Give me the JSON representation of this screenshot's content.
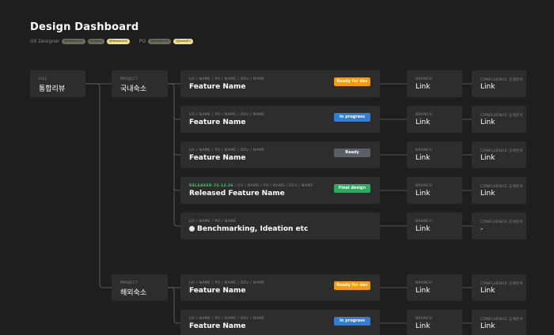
{
  "header": {
    "title": "Design Dashboard",
    "ux_label": "UX Designer",
    "ux_chips": [
      "@Member/UX",
      "@Design",
      "@Member/UX"
    ],
    "sep": "·",
    "po_label": "PO",
    "po_chips": [
      "@Member/PO",
      "@Jones/PO"
    ]
  },
  "file": {
    "label": "FILE",
    "name": "통합리뷰"
  },
  "projects": [
    {
      "label": "PROJECT",
      "name": "국내숙소"
    },
    {
      "label": "PROJECT",
      "name": "해외숙소"
    }
  ],
  "features": [
    {
      "meta": "UX / NAME / PO / NAME / DEV / NAME",
      "released": "",
      "title": "Feature Name",
      "status": "Ready for dev",
      "status_color": "#f39c12",
      "branch_label": "BRANCH",
      "branch": "Link",
      "conf_label": "CONFLUENCE 상세문서",
      "conf": "Link"
    },
    {
      "meta": "UX / NAME / PO / NAME / DEV / NAME",
      "released": "",
      "title": "Feature Name",
      "status": "In progress",
      "status_color": "#2f7ed8",
      "branch_label": "BRANCH",
      "branch": "Link",
      "conf_label": "CONFLUENCE 상세문서",
      "conf": "Link"
    },
    {
      "meta": "UX / NAME / PO / NAME / DEV / NAME",
      "released": "",
      "title": "Feature Name",
      "status": "Ready",
      "status_color": "#5b5f66",
      "branch_label": "BRANCH",
      "branch": "Link",
      "conf_label": "CONFLUENCE 상세문서",
      "conf": "Link"
    },
    {
      "meta": " / UX / NAME / PO / NAME / DEV / NAME",
      "released": "RELEASED 23.12.26",
      "title": "Released Feature Name",
      "status": "Final design",
      "status_color": "#27ae60",
      "branch_label": "BRANCH",
      "branch": "Link",
      "conf_label": "CONFLUENCE 상세문서",
      "conf": "Link"
    },
    {
      "meta": "UX / NAME / PO / NAME",
      "released": "",
      "title": "Benchmarking, Ideation etc",
      "status": "",
      "status_color": "",
      "branch_label": "BRANCH",
      "branch": "Link",
      "conf_label": "CONFLUENCE 상세문서",
      "conf": "-"
    },
    {
      "meta": "UX / NAME / PO / NAME / DEV / NAME",
      "released": "",
      "title": "Feature Name",
      "status": "Ready for dev",
      "status_color": "#f39c12",
      "branch_label": "BRANCH",
      "branch": "Link",
      "conf_label": "CONFLUENCE 상세문서",
      "conf": "Link"
    },
    {
      "meta": "UX / NAME / PO / NAME / DEV / NAME",
      "released": "",
      "title": "Feature Name",
      "status": "In progress",
      "status_color": "#2f7ed8",
      "branch_label": "BRANCH",
      "branch": "Link",
      "conf_label": "CONFLUENCE 상세문서",
      "conf": "Link"
    }
  ],
  "colors": {
    "background": "#1e1e1e",
    "card": "#2d2d2d",
    "connector": "#6a6a6a"
  }
}
